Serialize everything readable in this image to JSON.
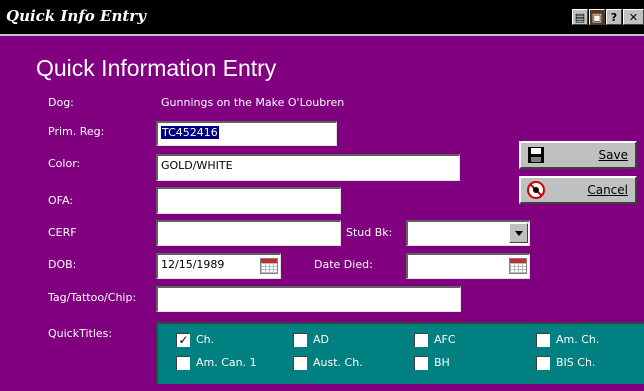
{
  "window": {
    "title": "Quick Info Entry",
    "buttons": [
      {
        "name": "print-icon",
        "glyph": "▦"
      },
      {
        "name": "dog-icon",
        "glyph": "▣"
      },
      {
        "name": "help-button",
        "glyph": "?"
      },
      {
        "name": "close-button",
        "glyph": "✕"
      }
    ]
  },
  "form": {
    "heading": "Quick Information Entry",
    "dog_label": "Dog:",
    "dog_value": "Gunnings on the Make O'Loubren",
    "prim_reg_label": "Prim. Reg:",
    "prim_reg_value": "TC452416",
    "color_label": "Color:",
    "color_value": "GOLD/WHITE",
    "ofa_label": "OFA:",
    "ofa_value": "",
    "cerf_label": "CERF",
    "cerf_value": "",
    "stud_bk_label": "Stud Bk:",
    "stud_bk_value": "",
    "dob_label": "DOB:",
    "dob_value": "12/15/1989",
    "date_died_label": "Date Died:",
    "date_died_value": "",
    "tag_label": "Tag/Tattoo/Chip:",
    "tag_value": "",
    "quicktitles_label": "QuickTitles:"
  },
  "actions": {
    "save_label": "Save",
    "cancel_label": "Cancel"
  },
  "quicktitles": [
    {
      "label": "Ch.",
      "checked": true
    },
    {
      "label": "AD",
      "checked": false
    },
    {
      "label": "AFC",
      "checked": false
    },
    {
      "label": "Am. Ch.",
      "checked": false
    },
    {
      "label": "Am. Can. 1",
      "checked": false
    },
    {
      "label": "Aust. Ch.",
      "checked": false
    },
    {
      "label": "BH",
      "checked": false
    },
    {
      "label": "BIS Ch.",
      "checked": false
    }
  ],
  "colors": {
    "background": "#800080",
    "titles_box": "#008080",
    "selection": "#000080"
  }
}
